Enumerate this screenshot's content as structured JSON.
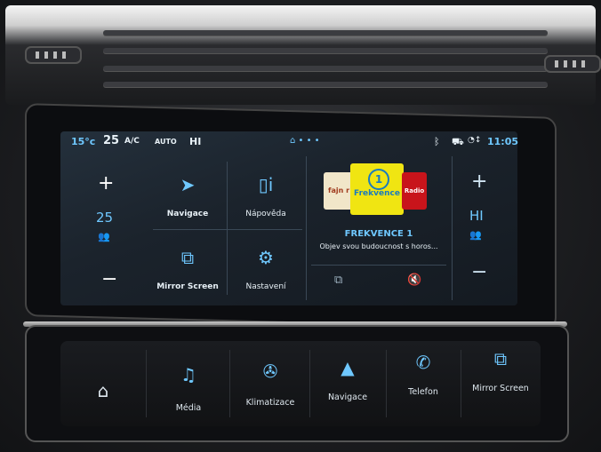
{
  "status_bar": {
    "left_temp": "15°c",
    "set_temp": "25",
    "ac": "A/C",
    "auto": "AUTO",
    "fan": "HI",
    "time": "11:05",
    "icons": [
      "bluetooth-icon",
      "car-icon",
      "signal-icon"
    ]
  },
  "left_climate": {
    "plus": "+",
    "temp": "25",
    "minus": "−"
  },
  "right_climate": {
    "plus": "+",
    "fan": "HI",
    "minus": "−"
  },
  "tiles": [
    {
      "label": "Navigace",
      "icon": "navigation-icon"
    },
    {
      "label": "Nápověda",
      "icon": "help-book-icon"
    },
    {
      "label": "Mirror Screen",
      "icon": "mirror-screen-icon"
    },
    {
      "label": "Nastavení",
      "icon": "settings-gear-icon"
    }
  ],
  "radio": {
    "logos": [
      "fajn r",
      "Frekvence",
      "Radio"
    ],
    "station": "FREKVENCE 1",
    "description": "Objev svou budoucnost s horos..."
  },
  "bottom_bar": [
    {
      "label": "",
      "icon": "home-icon"
    },
    {
      "label": "Média",
      "icon": "music-icon"
    },
    {
      "label": "Klimatizace",
      "icon": "climate-icon"
    },
    {
      "label": "Navigace",
      "icon": "navigation-icon"
    },
    {
      "label": "Telefon",
      "icon": "phone-icon"
    },
    {
      "label": "Mirror Screen",
      "icon": "mirror-screen-icon"
    }
  ]
}
